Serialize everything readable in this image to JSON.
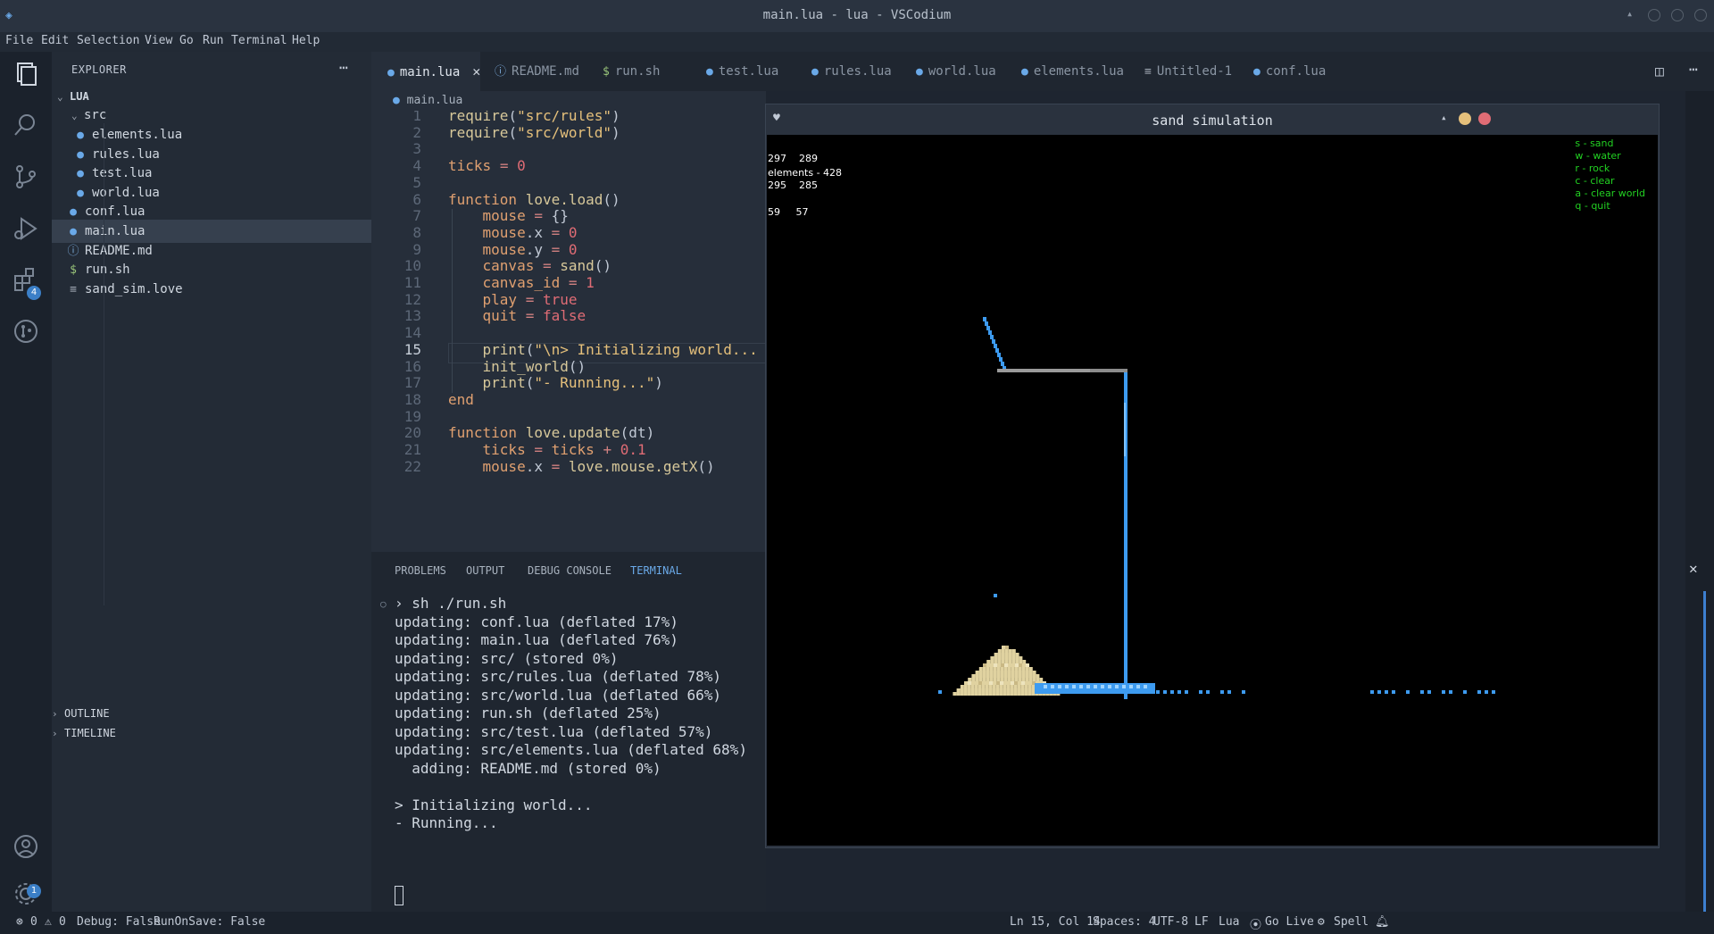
{
  "window": {
    "title": "main.lua - lua - VSCodium"
  },
  "menu": [
    "File",
    "Edit",
    "Selection",
    "View",
    "Go",
    "Run",
    "Terminal",
    "Help"
  ],
  "explorer": {
    "header": "EXPLORER",
    "folder": "LUA",
    "items": [
      {
        "label": "src",
        "type": "folder"
      },
      {
        "label": "elements.lua",
        "type": "lua"
      },
      {
        "label": "rules.lua",
        "type": "lua"
      },
      {
        "label": "test.lua",
        "type": "lua"
      },
      {
        "label": "world.lua",
        "type": "lua"
      },
      {
        "label": "conf.lua",
        "type": "lua"
      },
      {
        "label": "main.lua",
        "type": "lua"
      },
      {
        "label": "README.md",
        "type": "info"
      },
      {
        "label": "run.sh",
        "type": "sh"
      },
      {
        "label": "sand_sim.love",
        "type": "file"
      }
    ],
    "outline": "OUTLINE",
    "timeline": "TIMELINE"
  },
  "badges": {
    "extensions": "4",
    "settings": "1"
  },
  "tabs": [
    {
      "label": "main.lua",
      "icon": "lua"
    },
    {
      "label": "README.md",
      "icon": "info"
    },
    {
      "label": "run.sh",
      "icon": "sh"
    },
    {
      "label": "test.lua",
      "icon": "lua"
    },
    {
      "label": "rules.lua",
      "icon": "lua"
    },
    {
      "label": "world.lua",
      "icon": "lua"
    },
    {
      "label": "elements.lua",
      "icon": "lua"
    },
    {
      "label": "Untitled-1",
      "icon": "file"
    },
    {
      "label": "conf.lua",
      "icon": "lua"
    }
  ],
  "breadcrumb": "main.lua",
  "editor": {
    "current_line": 15,
    "lines": [
      {
        "n": "1",
        "html": "<span class='fn'>require</span>(<span class='str'>\"src/rules\"</span>)"
      },
      {
        "n": "2",
        "html": "<span class='fn'>require</span>(<span class='str'>\"src/world\"</span>)"
      },
      {
        "n": "3",
        "html": ""
      },
      {
        "n": "4",
        "html": "<span class='kw'>ticks</span> <span class='op'>=</span> <span class='num'>0</span>"
      },
      {
        "n": "5",
        "html": ""
      },
      {
        "n": "6",
        "html": "<span class='kw'>function</span> <span class='fn'>love.load</span>()"
      },
      {
        "n": "7",
        "html": "    <span class='kw'>mouse</span> <span class='op'>=</span> {}"
      },
      {
        "n": "8",
        "html": "    <span class='kw'>mouse</span>.x <span class='op'>=</span> <span class='num'>0</span>"
      },
      {
        "n": "9",
        "html": "    <span class='kw'>mouse</span>.y <span class='op'>=</span> <span class='num'>0</span>"
      },
      {
        "n": "10",
        "html": "    <span class='kw'>canvas</span> <span class='op'>=</span> <span class='fn'>sand</span>()"
      },
      {
        "n": "11",
        "html": "    <span class='kw'>canvas_id</span> <span class='op'>=</span> <span class='num'>1</span>"
      },
      {
        "n": "12",
        "html": "    <span class='kw'>play</span> <span class='op'>=</span> <span class='num'>true</span>"
      },
      {
        "n": "13",
        "html": "    <span class='kw'>quit</span> <span class='op'>=</span> <span class='num'>false</span>"
      },
      {
        "n": "14",
        "html": ""
      },
      {
        "n": "15",
        "html": "    <span class='fn'>print</span>(<span class='str'>\"\\n&gt; Initializing world...</span>"
      },
      {
        "n": "16",
        "html": "    <span class='fn'>init_world</span>()"
      },
      {
        "n": "17",
        "html": "    <span class='fn'>print</span>(<span class='str'>\"- Running...\"</span>)"
      },
      {
        "n": "18",
        "html": "<span class='kw'>end</span>"
      },
      {
        "n": "19",
        "html": ""
      },
      {
        "n": "20",
        "html": "<span class='kw'>function</span> <span class='fn'>love.update</span>(dt)"
      },
      {
        "n": "21",
        "html": "    <span class='kw'>ticks</span> <span class='op'>=</span> <span class='kw'>ticks</span> <span class='op'>+</span> <span class='num'>0.1</span>"
      },
      {
        "n": "22",
        "html": "    <span class='kw'>mouse</span>.x <span class='op'>=</span> <span class='fn'>love.mouse.getX</span>()"
      }
    ]
  },
  "panel": {
    "tabs": [
      "PROBLEMS",
      "OUTPUT",
      "DEBUG CONSOLE",
      "TERMINAL"
    ],
    "terminal": [
      "› sh ./run.sh",
      "updating: conf.lua (deflated 17%)",
      "updating: main.lua (deflated 76%)",
      "updating: src/ (stored 0%)",
      "updating: src/rules.lua (deflated 78%)",
      "updating: src/world.lua (deflated 66%)",
      "updating: run.sh (deflated 25%)",
      "updating: src/test.lua (deflated 57%)",
      "updating: src/elements.lua (deflated 68%)",
      "  adding: README.md (stored 0%)",
      "",
      "> Initializing world...",
      "- Running..."
    ]
  },
  "status": {
    "errors": "0",
    "warnings": "0",
    "debug": "Debug: False",
    "runonsave": "RunOnSave: False",
    "position": "Ln 15, Col 14",
    "spaces": "Spaces: 4",
    "encoding": "UTF-8",
    "eol": "LF",
    "language": "Lua",
    "golive": "Go Live",
    "spell": "Spell"
  },
  "love": {
    "title": "sand simulation",
    "hud_lines": [
      "297    289",
      "295    285",
      "59     57"
    ],
    "elements": "elements - 428",
    "help": [
      "s - sand",
      "w - water",
      "r - rock",
      "c - clear",
      "a - clear world",
      "q - quit"
    ]
  },
  "colors": {
    "water": "#3d9bf0",
    "sand": "#e0d2a0",
    "rock": "#8c8c8c",
    "help_text": "#22d122"
  }
}
